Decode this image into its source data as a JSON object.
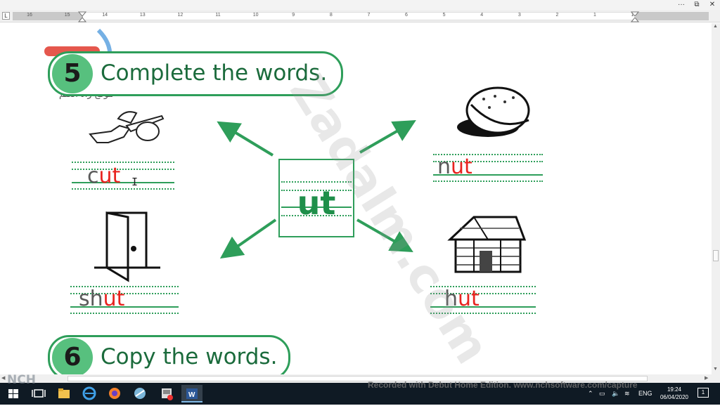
{
  "window": {
    "more_label": "···",
    "restore_label": "⧉",
    "close_label": "✕"
  },
  "ruler": {
    "corner_label": "L",
    "ticks": [
      "16",
      "15",
      "14",
      "13",
      "12",
      "11",
      "10",
      "9",
      "8",
      "7",
      "6",
      "5",
      "4",
      "3",
      "2",
      "1",
      "1"
    ]
  },
  "page": {
    "section5": {
      "number": "5",
      "title": "Complete the words."
    },
    "section6": {
      "number": "6",
      "title": "Copy the words."
    },
    "center_word": "ut",
    "words": [
      {
        "prefix": "c",
        "suffix": "ut"
      },
      {
        "prefix": "n",
        "suffix": "ut"
      },
      {
        "prefix": "sh",
        "suffix": "ut"
      },
      {
        "prefix": "h",
        "suffix": "ut"
      }
    ],
    "watermark_arabic": "موقع زاد العلم",
    "watermark": "Zadalm.com"
  },
  "taskbar": {
    "recorded_text": "Recorded with Debut Home Edition. www.nchsoftware.com/capture",
    "nch_text": "NCH",
    "language": "ENG",
    "time": "19:24",
    "date": "06/04/2020",
    "notification_count": "1"
  },
  "colors": {
    "accent": "#2e9e5a",
    "suffix_red": "#e8231f",
    "taskbar": "#0f1a24"
  }
}
